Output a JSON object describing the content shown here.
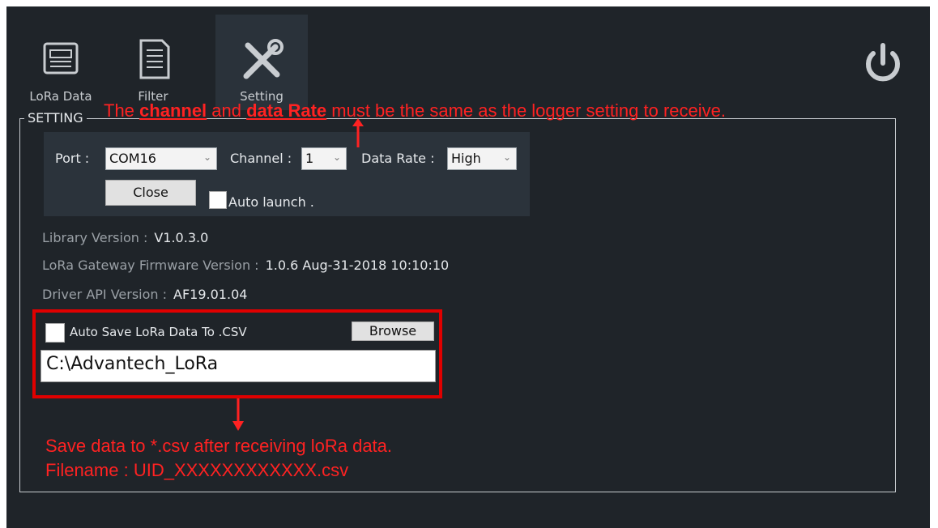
{
  "toolbar": {
    "tabs": [
      {
        "label": "LoRa Data",
        "icon": "news-icon"
      },
      {
        "label": "Filter",
        "icon": "document-list-icon"
      },
      {
        "label": "Setting",
        "icon": "tools-icon"
      }
    ],
    "active_tab": "Setting",
    "power_icon": "power-icon"
  },
  "setting": {
    "group_title": "SETTING",
    "port_label": "Port :",
    "port_value": "COM16",
    "channel_label": "Channel :",
    "channel_value": "1",
    "data_rate_label": "Data Rate :",
    "data_rate_value": "High",
    "close_button": "Close",
    "auto_launch_label": "Auto launch .",
    "library_version_label": "Library Version :",
    "library_version_value": "V1.0.3.0",
    "firmware_label": "LoRa Gateway Firmware Version :",
    "firmware_value": "1.0.6 Aug-31-2018 10:10:10",
    "driver_label": "Driver API Version :",
    "driver_value": "AF19.01.04",
    "auto_save_label": "Auto Save LoRa Data To .CSV",
    "browse_button": "Browse",
    "save_path": "C:\\Advantech_LoRa"
  },
  "annotations": {
    "top_pre": "The ",
    "top_b1": "channel",
    "top_mid": " and ",
    "top_b2": "data Rate",
    "top_post": " must be the same as the logger setting to receive.",
    "bottom_line1": "Save data to *.csv after receiving loRa data.",
    "bottom_line2": "Filename : UID_XXXXXXXXXXXX.csv"
  },
  "colors": {
    "background": "#1f2429",
    "annotation": "#ff2222"
  }
}
